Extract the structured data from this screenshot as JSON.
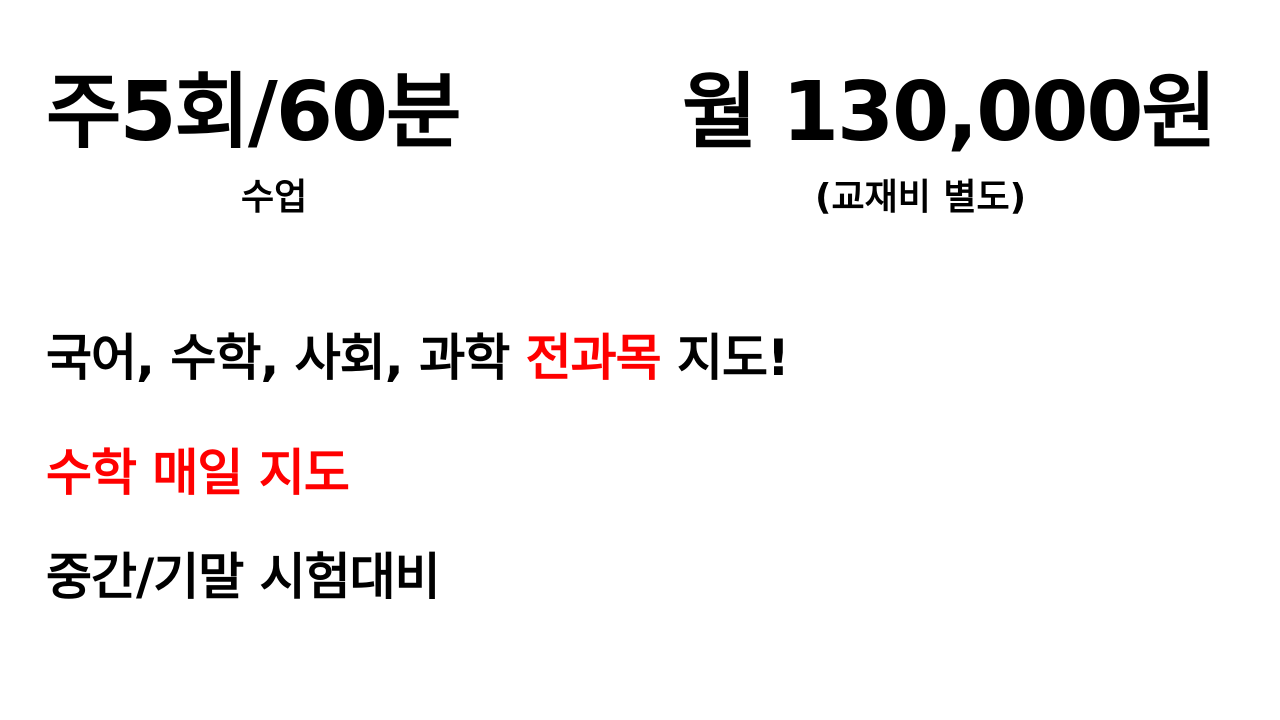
{
  "schedule": {
    "frequency": "주5회/60분",
    "frequency_sub": "수업"
  },
  "price": {
    "amount": "월 130,000원",
    "note": "(교재비 별도)"
  },
  "points": {
    "subjects_prefix": "국어, 수학, 사회, 과학 ",
    "subjects_highlight": "전과목",
    "subjects_suffix": " 지도!",
    "math_daily": "수학 매일 지도",
    "exam_prep": "중간/기말 시험대비"
  },
  "colors": {
    "text": "#000000",
    "highlight": "#ff0000",
    "background": "#ffffff"
  }
}
